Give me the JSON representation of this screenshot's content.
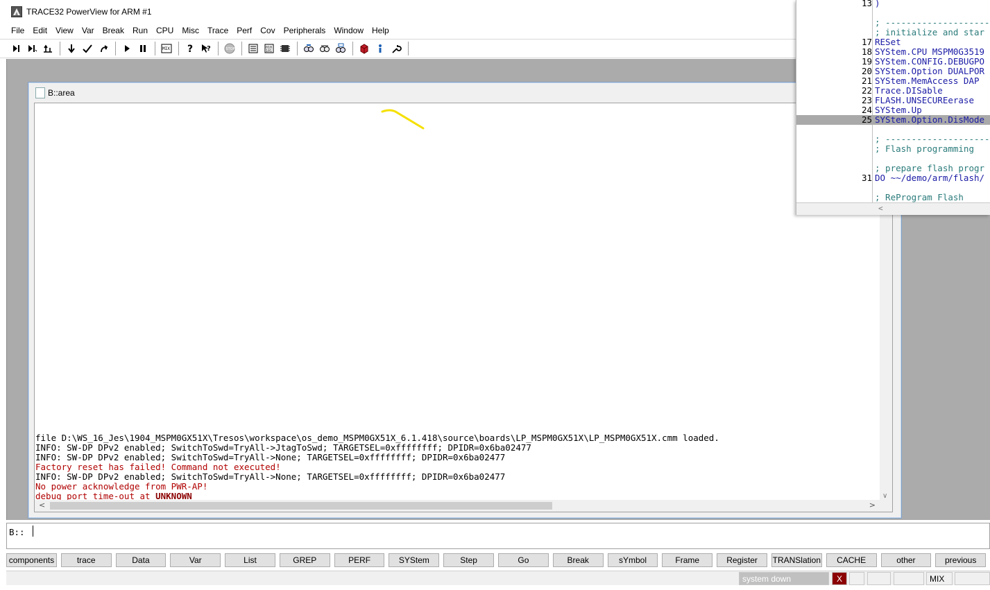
{
  "app": {
    "title": "TRACE32 PowerView for ARM #1"
  },
  "menubar": {
    "items": [
      "File",
      "Edit",
      "View",
      "Var",
      "Break",
      "Run",
      "CPU",
      "Misc",
      "Trace",
      "Perf",
      "Cov",
      "Peripherals",
      "Window",
      "Help"
    ]
  },
  "toolbar": {
    "icons": [
      "step-into-icon",
      "step-over-icon",
      "step-diverge-icon",
      "step-down-icon",
      "step-return-icon",
      "step-up-icon",
      "go-icon",
      "break-icon",
      "mode-icon",
      "help-icon",
      "context-help-icon",
      "stop-icon",
      "list-icon",
      "dump-icon",
      "register-icon",
      "watch-icon",
      "var-icon",
      "frame-icon",
      "reset-icon",
      "info-icon",
      "settings-icon"
    ]
  },
  "area_window": {
    "title": "B::area",
    "messages": [
      {
        "type": "info",
        "text": "file D:\\WS_16_Jes\\1904_MSPM0GX51X\\Tresos\\workspace\\os_demo_MSPM0GX51X_6.1.418\\source\\boards\\LP_MSPM0GX51X\\LP_MSPM0GX51X.cmm loaded."
      },
      {
        "type": "info",
        "text": "INFO: SW-DP DPv2 enabled; SwitchToSwd=TryAll->JtagToSwd; TARGETSEL=0xffffffff; DPIDR=0x6ba02477"
      },
      {
        "type": "info",
        "text": "INFO: SW-DP DPv2 enabled; SwitchToSwd=TryAll->None; TARGETSEL=0xffffffff; DPIDR=0x6ba02477"
      },
      {
        "type": "error",
        "text": "Factory reset has failed! Command not executed!"
      },
      {
        "type": "info",
        "text": "INFO: SW-DP DPv2 enabled; SwitchToSwd=TryAll->None; TARGETSEL=0xffffffff; DPIDR=0x6ba02477"
      },
      {
        "type": "error",
        "text": "No power acknowledge from PWR-AP!"
      },
      {
        "type": "error",
        "text": "debug port time-out at ",
        "bold": "UNKNOWN"
      }
    ]
  },
  "source_window": {
    "lines": [
      {
        "num": "13",
        "code": ")",
        "kind": "cmd"
      },
      {
        "num": "",
        "code": "",
        "kind": "cmd"
      },
      {
        "num": "",
        "code": "; ----------------------",
        "kind": "cmt"
      },
      {
        "num": "",
        "code": "; initialize and star",
        "kind": "cmt"
      },
      {
        "num": "17",
        "code": "RESet",
        "kind": "cmd"
      },
      {
        "num": "18",
        "code": "SYStem.CPU MSPM0G3519",
        "kind": "cmd"
      },
      {
        "num": "19",
        "code": "SYStem.CONFIG.DEBUGPO",
        "kind": "cmd"
      },
      {
        "num": "20",
        "code": "SYStem.Option DUALPOR",
        "kind": "cmd"
      },
      {
        "num": "21",
        "code": "SYStem.MemAccess DAP",
        "kind": "cmd"
      },
      {
        "num": "22",
        "code": "Trace.DISable",
        "kind": "cmd"
      },
      {
        "num": "23",
        "code": "FLASH.UNSECUREerase",
        "kind": "cmd"
      },
      {
        "num": "24",
        "code": "SYStem.Up",
        "kind": "cmd"
      },
      {
        "num": "25",
        "code": "SYStem.Option.DisMode",
        "kind": "cmd",
        "highlight": true
      },
      {
        "num": "",
        "code": "",
        "kind": "cmd"
      },
      {
        "num": "",
        "code": "; ----------------------",
        "kind": "cmt"
      },
      {
        "num": "",
        "code": "; Flash programming",
        "kind": "cmt"
      },
      {
        "num": "",
        "code": "",
        "kind": "cmd"
      },
      {
        "num": "",
        "code": "; prepare flash progr",
        "kind": "cmt"
      },
      {
        "num": "31",
        "code": "DO ~~/demo/arm/flash/",
        "kind": "cmd"
      },
      {
        "num": "",
        "code": "",
        "kind": "cmd"
      },
      {
        "num": "",
        "code": "; ReProgram Flash",
        "kind": "cmt"
      }
    ]
  },
  "cmdline": {
    "prompt": "B::"
  },
  "softkeys": [
    {
      "label": "components",
      "w": 73
    },
    {
      "label": "trace",
      "w": 73
    },
    {
      "label": "Data",
      "w": 73
    },
    {
      "label": "Var",
      "w": 73
    },
    {
      "label": "List",
      "w": 73
    },
    {
      "label": "GREP",
      "w": 73
    },
    {
      "label": "PERF",
      "w": 73
    },
    {
      "label": "SYStem",
      "w": 73
    },
    {
      "label": "Step",
      "w": 73
    },
    {
      "label": "Go",
      "w": 73
    },
    {
      "label": "Break",
      "w": 73
    },
    {
      "label": "sYmbol",
      "w": 73
    },
    {
      "label": "Frame",
      "w": 73
    },
    {
      "label": "Register",
      "w": 73
    },
    {
      "label": "TRANSlation",
      "w": 73
    },
    {
      "label": "CACHE",
      "w": 73
    },
    {
      "label": "other",
      "w": 73
    },
    {
      "label": "previous",
      "w": 73
    }
  ],
  "statusbar": {
    "state": "system down",
    "x_label": "X",
    "mode": "MIX"
  }
}
